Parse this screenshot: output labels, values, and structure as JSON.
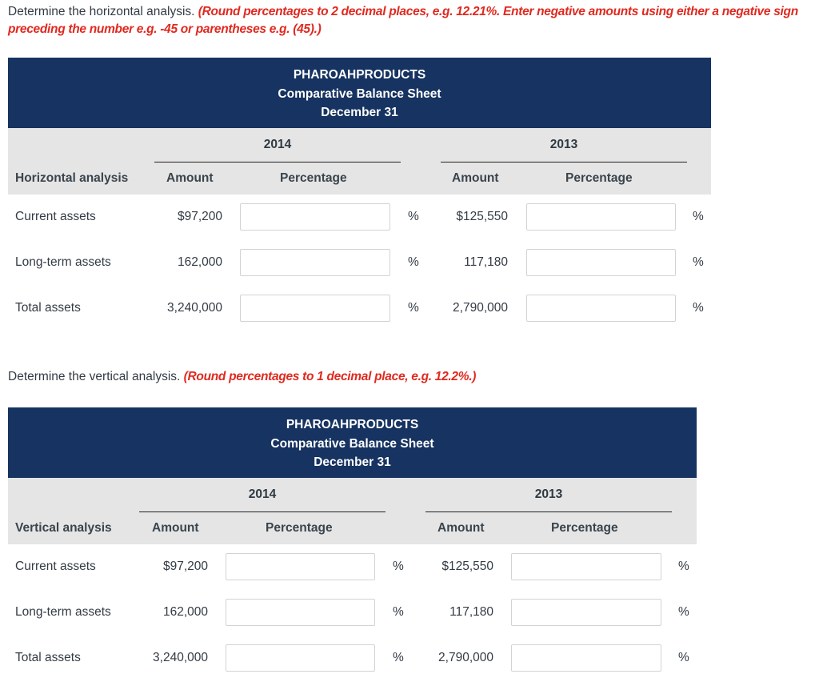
{
  "horizontal": {
    "instruction_plain": "Determine the horizontal analysis. ",
    "instruction_red_line1": "(Round percentages to 2 decimal places, e.g. 12.21%. Enter negative amounts using either a negative sign",
    "instruction_red_line2": "preceding the number e.g. -45 or parentheses e.g. (45).)",
    "banner": {
      "company": "PHAROAHPRODUCTS",
      "statement": "Comparative Balance Sheet",
      "date": "December 31"
    },
    "year_2014": "2014",
    "year_2013": "2013",
    "row_header": "Horizontal analysis",
    "col_amount": "Amount",
    "col_percentage": "Percentage",
    "pct_symbol": "%",
    "rows": [
      {
        "label": "Current assets",
        "amount_2014": "$97,200",
        "pct_2014": "",
        "amount_2013": "$125,550",
        "pct_2013": ""
      },
      {
        "label": "Long-term assets",
        "amount_2014": "162,000",
        "pct_2014": "",
        "amount_2013": "117,180",
        "pct_2013": ""
      },
      {
        "label": "Total assets",
        "amount_2014": "3,240,000",
        "pct_2014": "",
        "amount_2013": "2,790,000",
        "pct_2013": ""
      }
    ]
  },
  "vertical": {
    "instruction_plain": "Determine the vertical analysis. ",
    "instruction_red": "(Round percentages to 1 decimal place, e.g. 12.2%.)",
    "banner": {
      "company": "PHAROAHPRODUCTS",
      "statement": "Comparative Balance Sheet",
      "date": "December 31"
    },
    "year_2014": "2014",
    "year_2013": "2013",
    "row_header": "Vertical analysis",
    "col_amount": "Amount",
    "col_percentage": "Percentage",
    "pct_symbol": "%",
    "rows": [
      {
        "label": "Current assets",
        "amount_2014": "$97,200",
        "pct_2014": "",
        "amount_2013": "$125,550",
        "pct_2013": ""
      },
      {
        "label": "Long-term assets",
        "amount_2014": "162,000",
        "pct_2014": "",
        "amount_2013": "117,180",
        "pct_2013": ""
      },
      {
        "label": "Total assets",
        "amount_2014": "3,240,000",
        "pct_2014": "",
        "amount_2013": "2,790,000",
        "pct_2013": ""
      }
    ]
  }
}
